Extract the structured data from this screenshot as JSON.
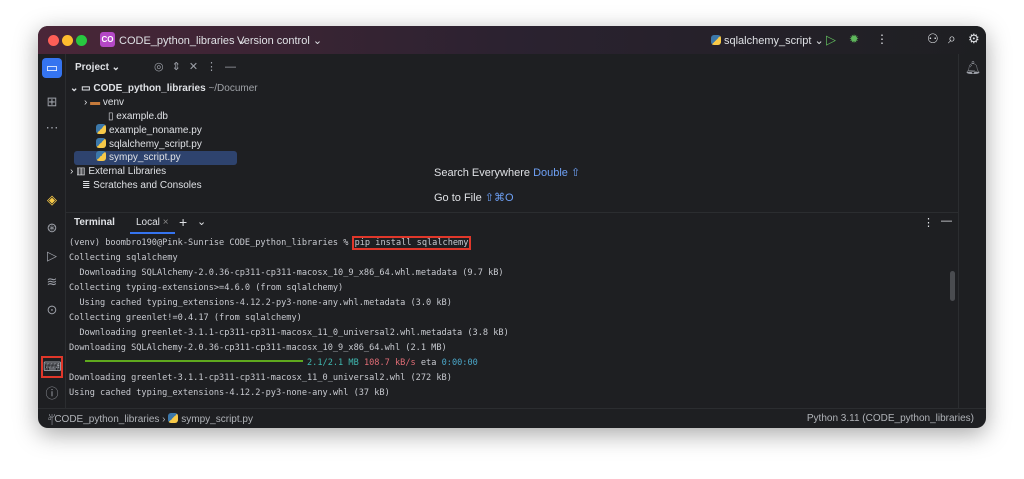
{
  "titlebar": {
    "project_badge": "CO",
    "project_name": "CODE_python_libraries",
    "vcs": "Version control",
    "run_config": "sqlalchemy_script"
  },
  "project_panel": {
    "title": "Project",
    "root": "CODE_python_libraries",
    "root_path": "~/Documer",
    "items": [
      "venv",
      "example.db",
      "example_noname.py",
      "sqlalchemy_script.py",
      "sympy_script.py",
      "External Libraries",
      "Scratches and Consoles"
    ]
  },
  "editor": {
    "hint1": "Search Everywhere",
    "hint1_key": "Double ⇧",
    "hint2": "Go to File",
    "hint2_key": "⇧⌘O"
  },
  "terminal": {
    "title": "Terminal",
    "tab": "Local",
    "prompt": "(venv) boombro190@Pink-Sunrise CODE_python_libraries % ",
    "command": "pip install sqlalchemy",
    "lines": [
      "Collecting sqlalchemy",
      "  Downloading SQLAlchemy-2.0.36-cp311-cp311-macosx_10_9_x86_64.whl.metadata (9.7 kB)",
      "Collecting typing-extensions>=4.6.0 (from sqlalchemy)",
      "  Using cached typing_extensions-4.12.2-py3-none-any.whl.metadata (3.0 kB)",
      "Collecting greenlet!=0.4.17 (from sqlalchemy)",
      "  Downloading greenlet-3.1.1-cp311-cp311-macosx_11_0_universal2.whl.metadata (3.8 kB)",
      "Downloading SQLAlchemy-2.0.36-cp311-cp311-macosx_10_9_x86_64.whl (2.1 MB)"
    ],
    "progress": {
      "fraction": 1.0,
      "size": "2.1/2.1 MB",
      "speed": "108.7 kB/s",
      "eta_label": "eta",
      "eta": "0:00:00"
    },
    "lines_after": [
      "Downloading greenlet-3.1.1-cp311-cp311-macosx_11_0_universal2.whl (272 kB)",
      "Using cached typing_extensions-4.12.2-py3-none-any.whl (37 kB)"
    ]
  },
  "statusbar": {
    "crumb1": "CODE_python_libraries",
    "crumb2": "sympy_script.py",
    "interpreter": "Python 3.11 (CODE_python_libraries)"
  },
  "colors": {
    "highlight": "#e0372a",
    "selection": "#2e436e",
    "progress": "#5fa91e"
  }
}
